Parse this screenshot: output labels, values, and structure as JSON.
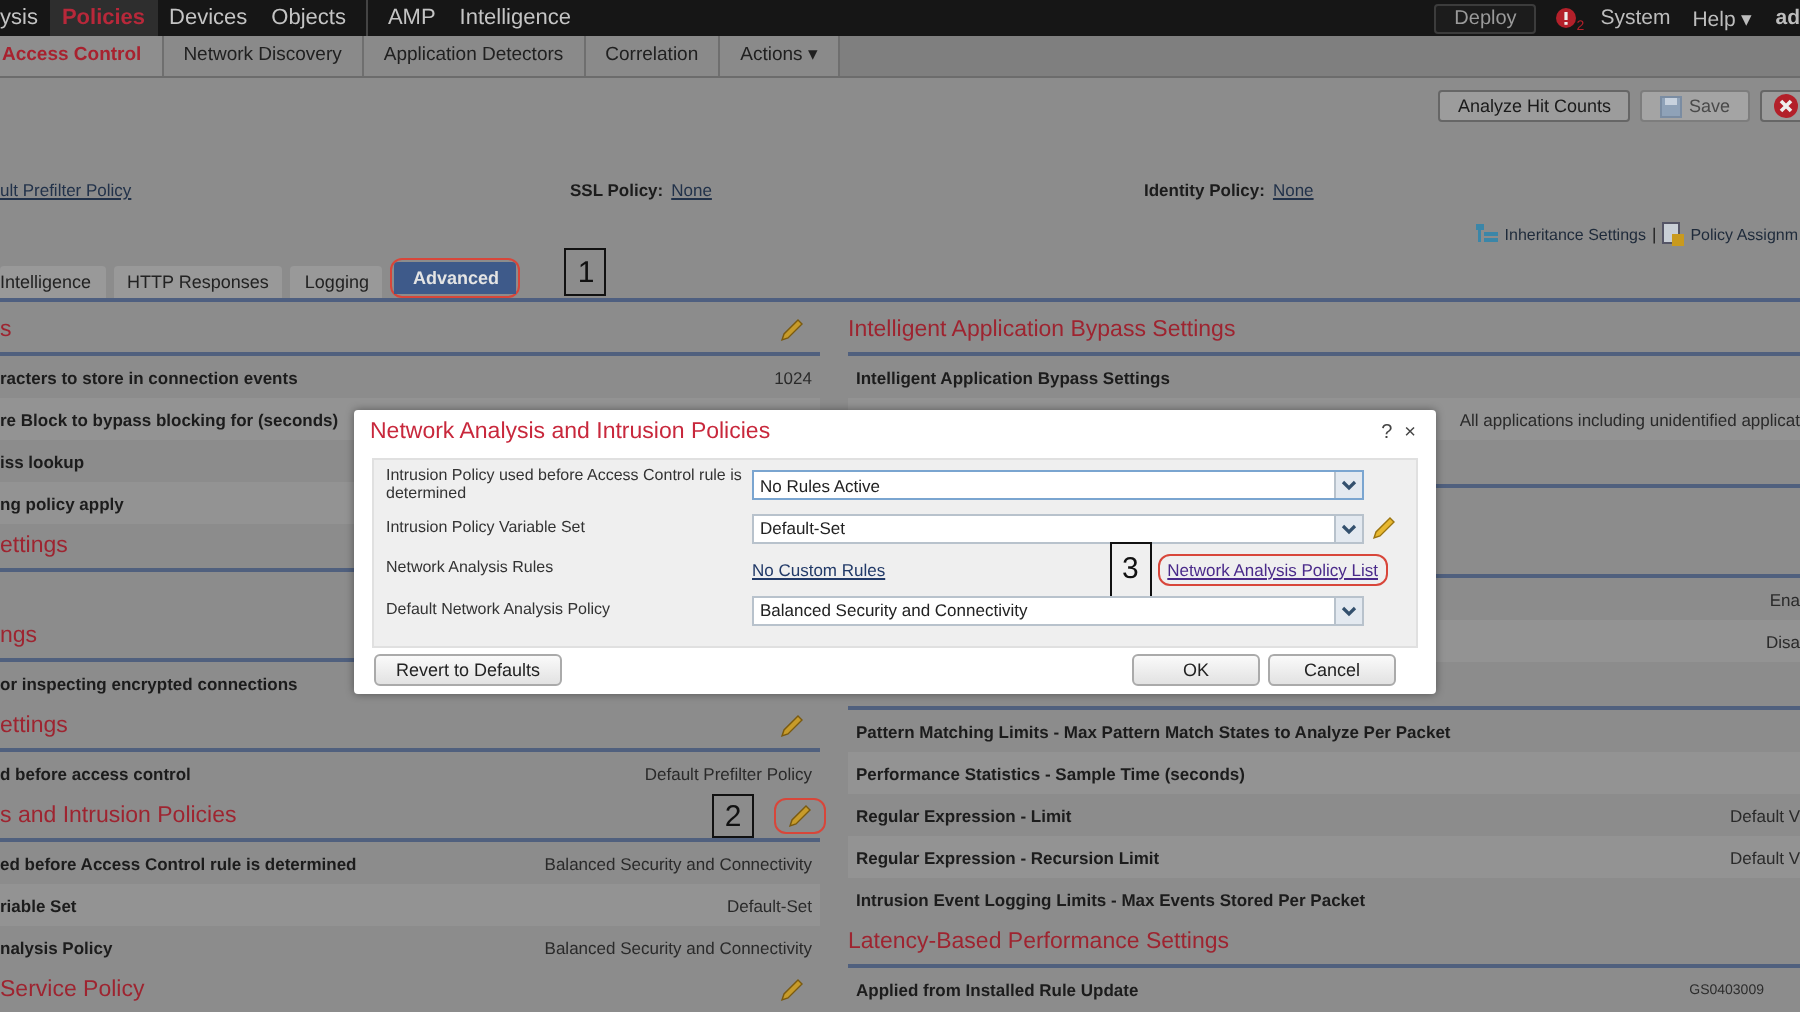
{
  "top_nav": {
    "items": [
      {
        "label": "ysis",
        "selected": false
      },
      {
        "label": "Policies",
        "selected": true
      },
      {
        "label": "Devices",
        "selected": false
      },
      {
        "label": "Objects",
        "selected": false
      },
      {
        "label": "AMP",
        "selected": false
      },
      {
        "label": "Intelligence",
        "selected": false
      }
    ],
    "deploy": "Deploy",
    "alert_count": "2",
    "system": "System",
    "help": "Help ▾",
    "user": "ad"
  },
  "sub_nav": [
    {
      "label": "Access Control",
      "selected": true
    },
    {
      "label": "Network Discovery",
      "selected": false
    },
    {
      "label": "Application Detectors",
      "selected": false
    },
    {
      "label": "Correlation",
      "selected": false
    },
    {
      "label": "Actions ▾",
      "selected": false
    }
  ],
  "toolbar": [
    {
      "kind": "text",
      "label": "Analyze Hit Counts",
      "disabled": false
    },
    {
      "kind": "save",
      "label": "Save",
      "disabled": true
    },
    {
      "kind": "cancel",
      "disabled": false
    }
  ],
  "policies": [
    {
      "link": "ult Prefilter Policy"
    },
    {
      "label": "SSL Policy:",
      "link": "None"
    },
    {
      "label": "Identity Policy:",
      "link": "None"
    }
  ],
  "links_bar": {
    "items": [
      {
        "kind": "inheritance",
        "label": "Inheritance Settings"
      },
      {
        "kind": "assignment",
        "label": "Policy Assignm"
      }
    ],
    "separator": "|"
  },
  "tabs": [
    {
      "label": "Intelligence",
      "selected": false,
      "highlighted": false
    },
    {
      "label": "HTTP Responses",
      "selected": false,
      "highlighted": false
    },
    {
      "label": "Logging",
      "selected": false,
      "highlighted": false
    },
    {
      "label": "Advanced",
      "selected": true,
      "highlighted": true
    }
  ],
  "tabs_callout": "1",
  "left_sections": [
    {
      "title": "s",
      "edit_icon": true,
      "rows": [
        {
          "label": "racters to store in connection events",
          "value": "1024"
        },
        {
          "label": "re Block to bypass blocking for (seconds)"
        },
        {
          "label": "iss lookup"
        },
        {
          "label": "ng policy apply"
        }
      ]
    },
    {
      "title": "ettings",
      "rows": [
        {}
      ]
    },
    {
      "title": "ngs",
      "rows": [
        {
          "label": "or inspecting encrypted connections"
        }
      ]
    },
    {
      "title": "ettings",
      "edit_icon": true,
      "rows": [
        {
          "label": "d before access control",
          "value": "Default Prefilter Policy"
        }
      ]
    },
    {
      "title": "s and Intrusion Policies",
      "edit_icon": true,
      "callout": "2",
      "highlighted": true,
      "rows": [
        {
          "label": "ed before Access Control rule is determined",
          "value": "Balanced Security and Connectivity"
        },
        {
          "label": "riable Set",
          "value": "Default-Set"
        },
        {
          "label": "nalysis Policy",
          "value": "Balanced Security and Connectivity"
        }
      ]
    },
    {
      "title": "Service Policy",
      "edit_icon": true
    }
  ],
  "right_sections": [
    {
      "title": "Intelligent Application Bypass Settings",
      "rows": [
        {
          "label": "Intelligent Application Bypass Settings"
        },
        {
          "value": "All applications including unidentified applicat"
        }
      ]
    },
    {
      "rows": [
        {}
      ]
    },
    {
      "rows": [
        {
          "value": "Ena"
        },
        {
          "value": "Disa"
        }
      ]
    },
    {
      "rows": [
        {
          "label": "Pattern Matching Limits - Max Pattern Match States to Analyze Per Packet"
        },
        {
          "label": "Performance Statistics - Sample Time (seconds)"
        },
        {
          "label": "Regular Expression - Limit",
          "value": "Default V"
        },
        {
          "label": "Regular Expression - Recursion Limit",
          "value": "Default V"
        },
        {
          "label": "Intrusion Event Logging Limits - Max Events Stored Per Packet"
        }
      ]
    },
    {
      "title": "Latency-Based Performance Settings",
      "rows": [
        {
          "label": "Applied from Installed Rule Update"
        }
      ]
    }
  ],
  "dialog": {
    "title": "Network Analysis and Intrusion Policies",
    "help": "?",
    "close": "×",
    "fields": [
      {
        "kind": "select",
        "label": "Intrusion Policy used before Access Control rule is determined",
        "value": "No Rules Active",
        "focused": true
      },
      {
        "kind": "select",
        "label": "Intrusion Policy Variable Set",
        "value": "Default-Set",
        "focused": false,
        "edit_icon": true
      },
      {
        "kind": "links",
        "label": "Network Analysis Rules",
        "value": "No Custom Rules",
        "callout": "3",
        "extra_link": "Network Analysis Policy List",
        "highlighted": true
      },
      {
        "kind": "select",
        "label": "Default Network Analysis Policy",
        "value": "Balanced Security and Connectivity",
        "focused": false
      }
    ],
    "left_buttons": [
      "Revert to Defaults"
    ],
    "right_buttons": [
      "OK",
      "Cancel"
    ]
  },
  "figure_id": "GS0403009"
}
